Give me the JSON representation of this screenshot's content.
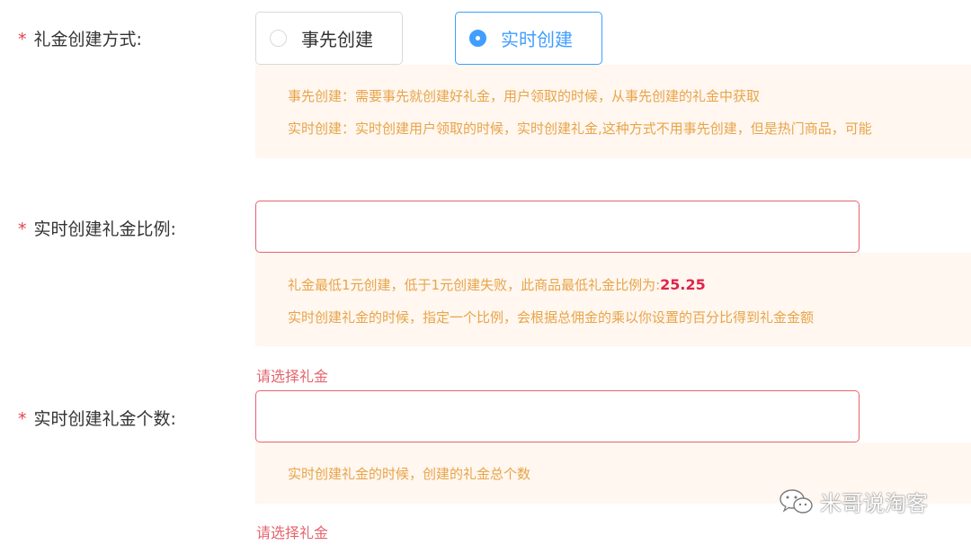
{
  "form": {
    "required_mark": "*",
    "creation_method": {
      "label": "礼金创建方式:",
      "options": [
        {
          "label": "事先创建",
          "selected": false
        },
        {
          "label": "实时创建",
          "selected": true
        }
      ],
      "tips": [
        "事先创建：需要事先就创建好礼金，用户领取的时候，从事先创建的礼金中获取",
        "实时创建：实时创建用户领取的时候，实时创建礼金,这种方式不用事先创建，但是热门商品，可能"
      ]
    },
    "ratio": {
      "label": "实时创建礼金比例:",
      "value": "",
      "tip_line1_prefix": "礼金最低1元创建，低于1元创建失败，此商品最低礼金比例为:",
      "tip_line1_value": "25.25",
      "tip_line2": "实时创建礼金的时候，指定一个比例，会根据总佣金的乘以你设置的百分比得到礼金金额",
      "error": "请选择礼金"
    },
    "count": {
      "label": "实时创建礼金个数:",
      "value": "",
      "tip": "实时创建礼金的时候，创建的礼金总个数",
      "error": "请选择礼金"
    }
  },
  "watermark": {
    "text": "米哥说淘客",
    "icon": "wechat-icon"
  },
  "colors": {
    "primary": "#409eff",
    "error": "#e5656d",
    "required": "#e0454b",
    "tip_text": "#e8a449",
    "tip_bg": "#fff7f0",
    "highlight": "#e0234a"
  }
}
